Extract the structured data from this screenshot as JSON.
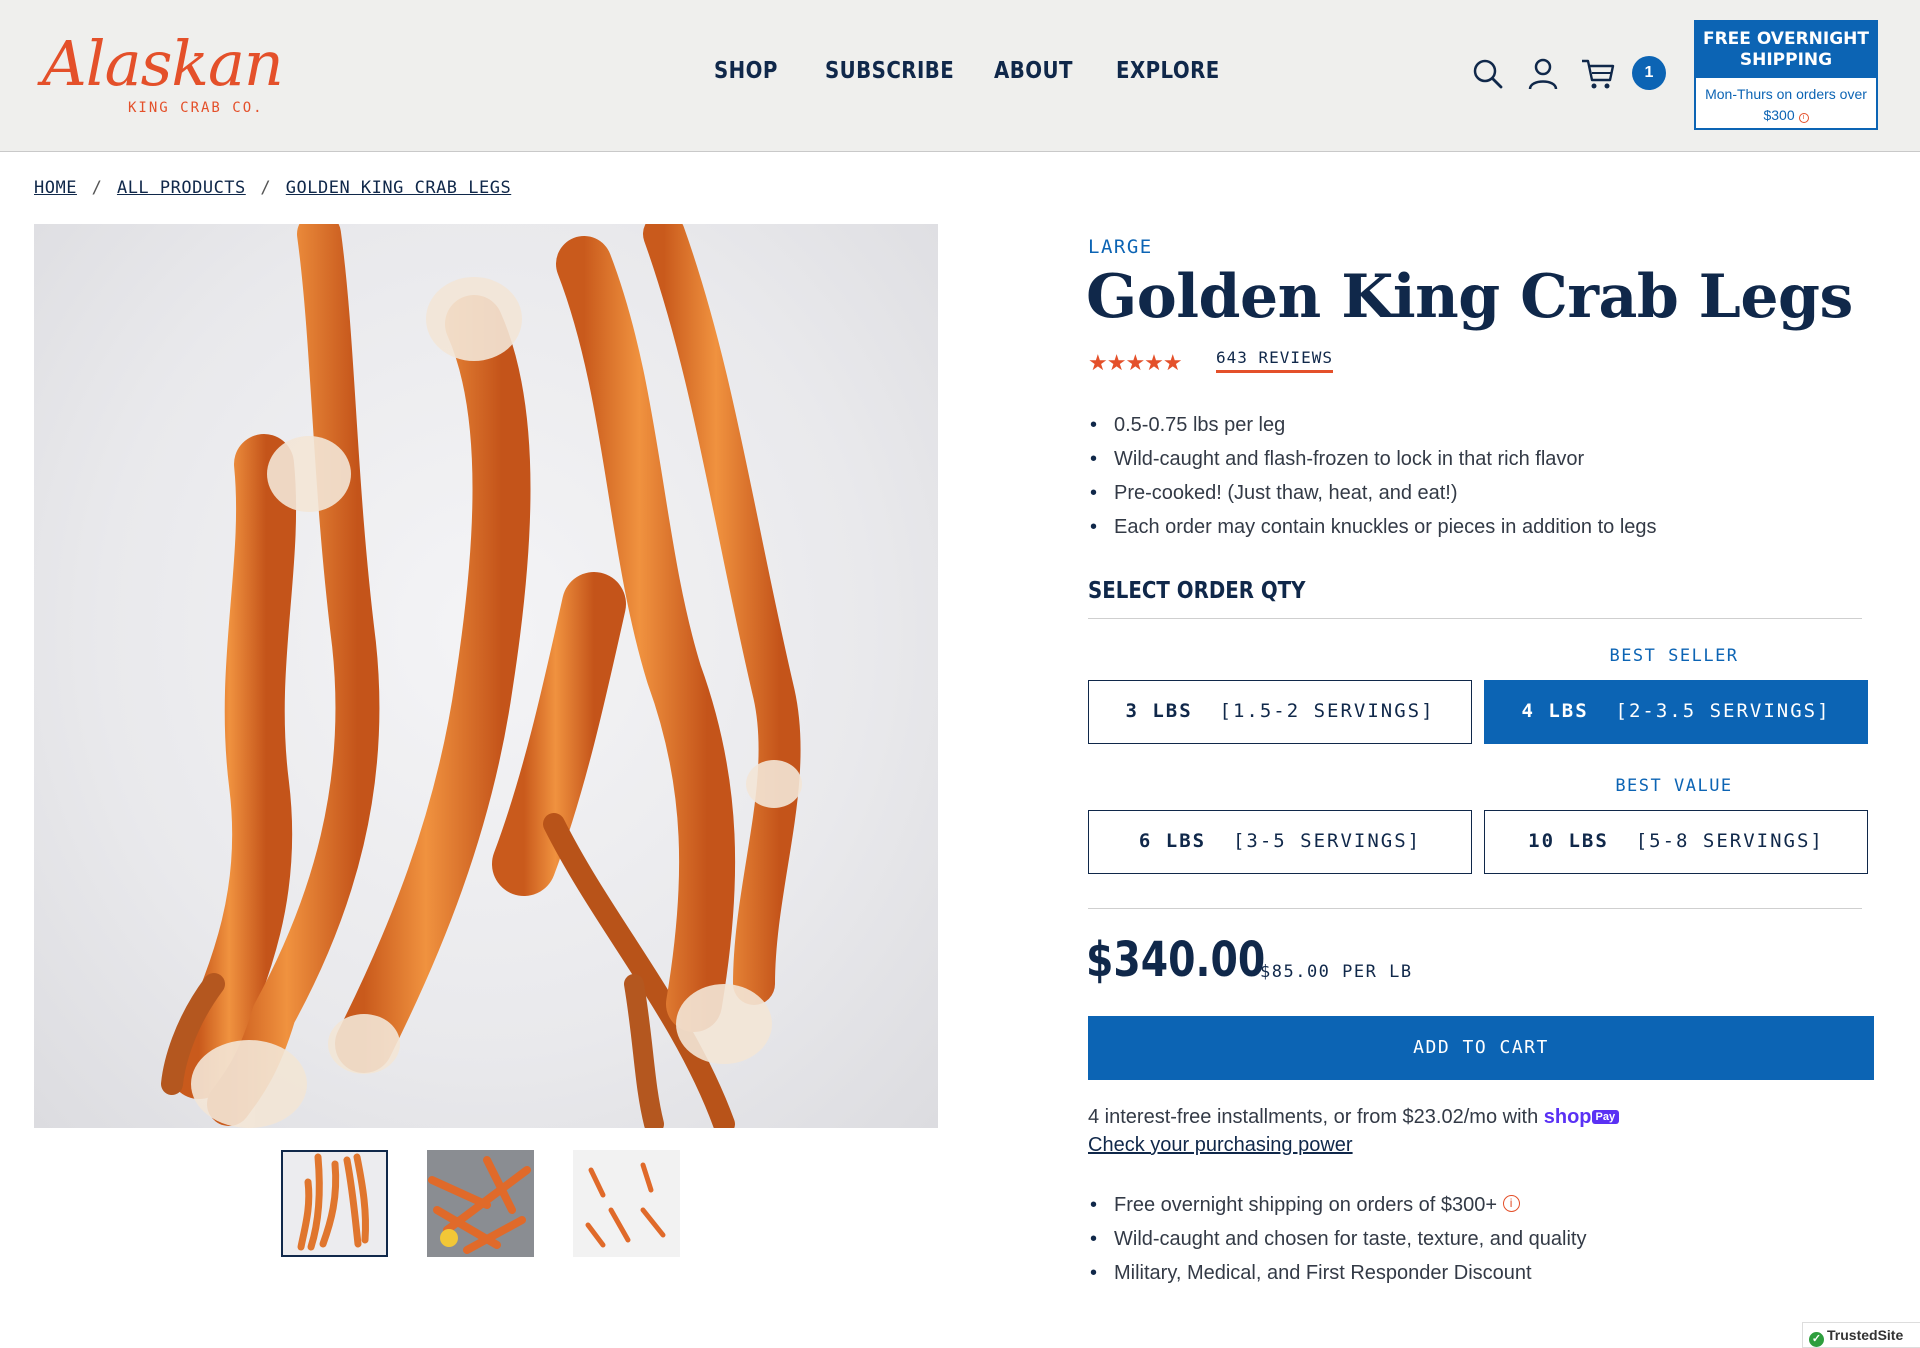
{
  "brand": {
    "script": "Alaskan",
    "sub": "KING CRAB CO."
  },
  "nav": [
    "SHOP",
    "SUBSCRIBE",
    "ABOUT",
    "EXPLORE"
  ],
  "header": {
    "cart_count": "1",
    "shipping_title": "FREE OVERNIGHT SHIPPING",
    "shipping_detail_1": "Mon-Thurs on orders over",
    "shipping_detail_2": "$300",
    "icons": [
      "search-icon",
      "account-icon",
      "cart-icon",
      "info-icon"
    ]
  },
  "breadcrumb": [
    "HOME",
    "ALL PRODUCTS",
    "GOLDEN KING CRAB LEGS"
  ],
  "product": {
    "eyebrow": "LARGE",
    "title": "Golden King Crab Legs",
    "stars": "★★★★★",
    "rating": 5,
    "reviews": "643 REVIEWS",
    "features": [
      "0.5-0.75 lbs per leg",
      "Wild-caught and flash-frozen to lock in that rich flavor",
      "Pre-cooked! (Just thaw, heat, and eat!)",
      "Each order may contain knuckles or pieces in addition to legs"
    ],
    "qty_label": "SELECT ORDER QTY",
    "tags": {
      "best_seller": "BEST SELLER",
      "best_value": "BEST VALUE"
    },
    "options": [
      {
        "amount": "3 LBS",
        "servings": "[1.5-2 SERVINGS]",
        "selected": false
      },
      {
        "amount": "4 LBS",
        "servings": "[2-3.5 SERVINGS]",
        "selected": true
      },
      {
        "amount": "6 LBS",
        "servings": "[3-5 SERVINGS]",
        "selected": false
      },
      {
        "amount": "10 LBS",
        "servings": "[5-8 SERVINGS]",
        "selected": false
      }
    ],
    "price": "$340.00",
    "per_lb": "$85.00 PER LB",
    "add_to_cart": "ADD TO CART",
    "installments": "4 interest-free installments, or from $23.02/mo with",
    "shop_logo": "shop",
    "shop_pay": "Pay",
    "purchasing_power": "Check your purchasing power",
    "perks": [
      "Free overnight shipping on orders of $300+",
      "Wild-caught and chosen for taste, texture, and quality",
      "Military, Medical, and First Responder Discount"
    ]
  },
  "trusted": "TrustedSite",
  "colors": {
    "navy": "#10284a",
    "blue": "#0c64b4",
    "orange": "#e4502a",
    "crab": "#d9732b"
  }
}
